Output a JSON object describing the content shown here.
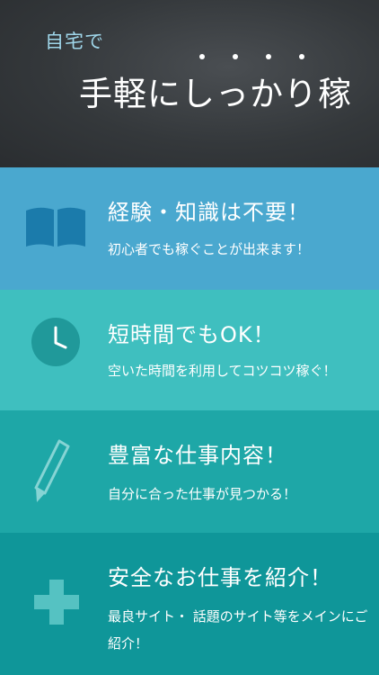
{
  "header": {
    "subtitle": "自宅で",
    "title": "手軽にしっかり稼"
  },
  "panels": [
    {
      "title": "経験・知識は不要！",
      "description": "初心者でも稼ぐことが出来ます！",
      "icon": "book-icon",
      "color": "#4aa8cf"
    },
    {
      "title": "短時間でもOK！",
      "description": "空いた時間を利用してコツコツ稼ぐ！",
      "icon": "clock-icon",
      "color": "#3fbfbf"
    },
    {
      "title": "豊富な仕事内容！",
      "description": "自分に合った仕事が見つかる！",
      "icon": "pencil-icon",
      "color": "#1ea7a7"
    },
    {
      "title": "安全なお仕事を紹介！",
      "description": "最良サイト・ 話題のサイト等をメインにご紹介！",
      "icon": "plus-icon",
      "color": "#0f9699"
    }
  ]
}
